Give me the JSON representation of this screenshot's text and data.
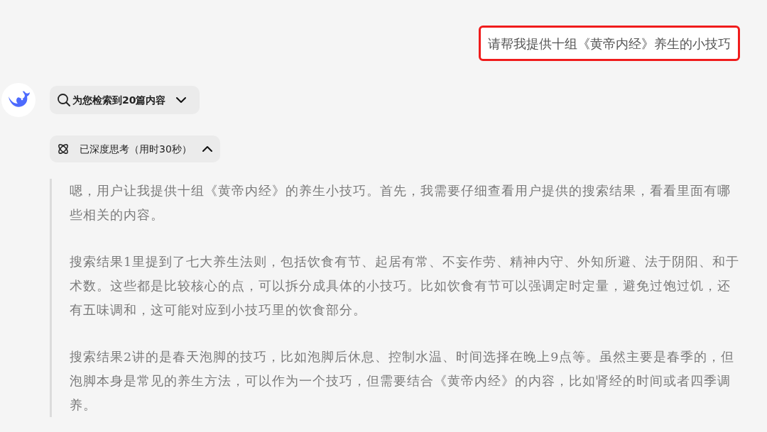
{
  "user_message": {
    "text": "请帮我提供十组《黄帝内经》养生的小技巧",
    "highlighted": true
  },
  "search_toggle": {
    "label": "为您检索到20篇内容",
    "expanded": false
  },
  "thinking_toggle": {
    "label": "已深度思考（用时30秒）",
    "expanded": true
  },
  "thinking_paragraphs": [
    "嗯，用户让我提供十组《黄帝内经》的养生小技巧。首先，我需要仔细查看用户提供的搜索结果，看看里面有哪些相关的内容。",
    "搜索结果1里提到了七大养生法则，包括饮食有节、起居有常、不妄作劳、精神内守、外知所避、法于阴阳、和于术数。这些都是比较核心的点，可以拆分成具体的小技巧。比如饮食有节可以强调定时定量，避免过饱过饥，还有五味调和，这可能对应到小技巧里的饮食部分。",
    "搜索结果2讲的是春天泡脚的技巧，比如泡脚后休息、控制水温、时间选择在晚上9点等。虽然主要是春季的，但泡脚本身是常见的养生方法，可以作为一个技巧，但需要结合《黄帝内经》的内容，比如肾经的时间或者四季调养。"
  ]
}
